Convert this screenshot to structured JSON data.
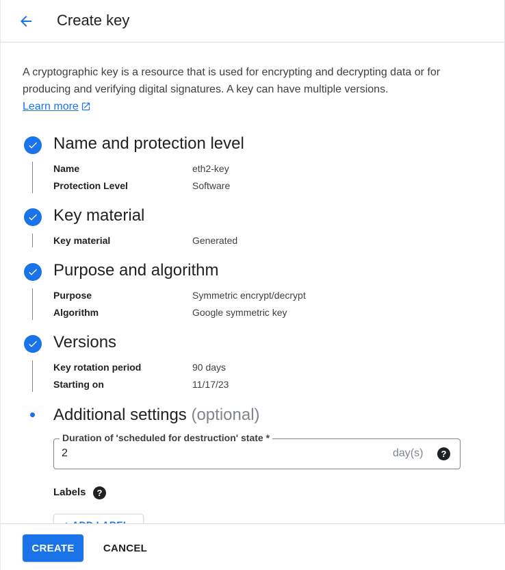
{
  "header": {
    "title": "Create key"
  },
  "intro": {
    "text": "A cryptographic key is a resource that is used for encrypting and decrypting data or for producing and verifying digital signatures. A key can have multiple versions.",
    "learn_more": "Learn more"
  },
  "steps": [
    {
      "title": "Name and protection level",
      "status": "complete",
      "rows": [
        {
          "label": "Name",
          "value": "eth2-key"
        },
        {
          "label": "Protection Level",
          "value": "Software"
        }
      ]
    },
    {
      "title": "Key material",
      "status": "complete",
      "rows": [
        {
          "label": "Key material",
          "value": "Generated"
        }
      ]
    },
    {
      "title": "Purpose and algorithm",
      "status": "complete",
      "rows": [
        {
          "label": "Purpose",
          "value": "Symmetric encrypt/decrypt"
        },
        {
          "label": "Algorithm",
          "value": "Google symmetric key"
        }
      ]
    },
    {
      "title": "Versions",
      "status": "complete",
      "rows": [
        {
          "label": "Key rotation period",
          "value": "90 days"
        },
        {
          "label": "Starting on",
          "value": "11/17/23"
        }
      ]
    },
    {
      "title": "Additional settings",
      "title_suffix": "(optional)",
      "status": "current"
    }
  ],
  "destruction_field": {
    "label": "Duration of 'scheduled for destruction' state *",
    "value": "2",
    "suffix": "day(s)"
  },
  "labels_section": {
    "title": "Labels",
    "add_label": "+ ADD LABEL"
  },
  "footer": {
    "create": "CREATE",
    "cancel": "CANCEL"
  },
  "colors": {
    "accent": "#1a73e8",
    "text": "#202124",
    "muted": "#80868b"
  }
}
